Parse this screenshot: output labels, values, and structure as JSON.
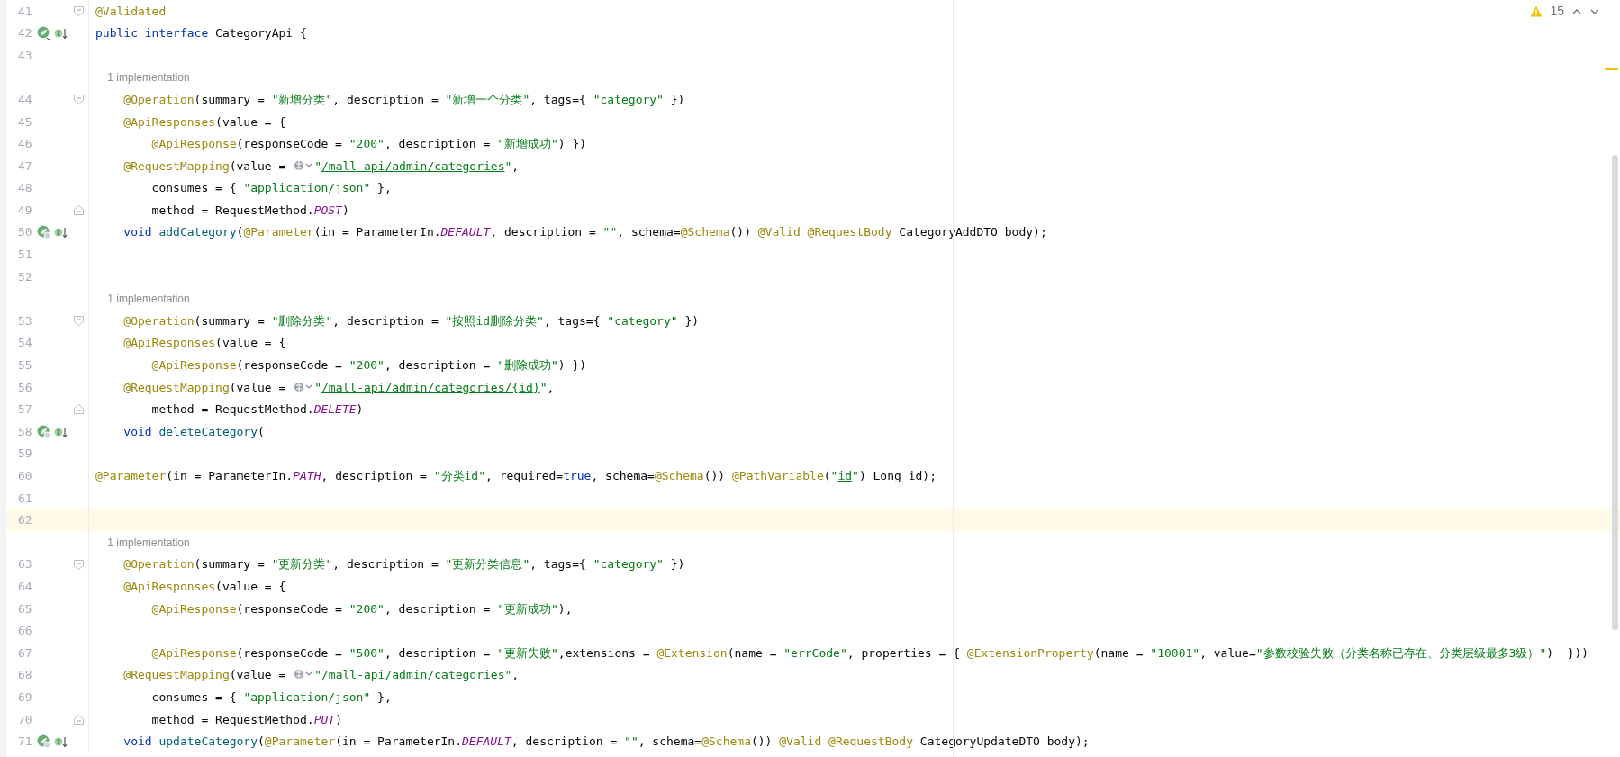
{
  "inspections": {
    "warning_count": "15"
  },
  "lines": [
    {
      "number": "41",
      "fold": {
        "kind": "start"
      },
      "tokens": [
        {
          "kind": "annotation",
          "text": "@Validated"
        }
      ]
    },
    {
      "number": "42",
      "gutter": {
        "kind": "bean"
      },
      "tokens": [
        {
          "kind": "keyword",
          "text": "public interface"
        },
        {
          "kind": "plain",
          "text": " CategoryApi {"
        }
      ]
    },
    {
      "number": "43"
    },
    {
      "hint": "    1 implementation"
    },
    {
      "number": "44",
      "fold": {
        "kind": "start"
      },
      "tokens": [
        {
          "kind": "annotation",
          "text": "    @Operation"
        },
        {
          "kind": "plain",
          "text": "(summary = "
        },
        {
          "kind": "string",
          "text": "\"新增分类\""
        },
        {
          "kind": "plain",
          "text": ", description = "
        },
        {
          "kind": "string",
          "text": "\"新增一个分类\""
        },
        {
          "kind": "plain",
          "text": ", tags={ "
        },
        {
          "kind": "string",
          "text": "\"category\""
        },
        {
          "kind": "plain",
          "text": " })"
        }
      ]
    },
    {
      "number": "45",
      "tokens": [
        {
          "kind": "annotation",
          "text": "    @ApiResponses"
        },
        {
          "kind": "plain",
          "text": "(value = {"
        }
      ]
    },
    {
      "number": "46",
      "tokens": [
        {
          "kind": "annotation",
          "text": "        @ApiResponse"
        },
        {
          "kind": "plain",
          "text": "(responseCode = "
        },
        {
          "kind": "string",
          "text": "\"200\""
        },
        {
          "kind": "plain",
          "text": ", description = "
        },
        {
          "kind": "string",
          "text": "\"新增成功\""
        },
        {
          "kind": "plain",
          "text": ") })"
        }
      ]
    },
    {
      "number": "47",
      "tokens": [
        {
          "kind": "annotation",
          "text": "    @RequestMapping"
        },
        {
          "kind": "plain",
          "text": "(value = "
        },
        {
          "kind": "web-inlay"
        },
        {
          "kind": "string",
          "text": "\""
        },
        {
          "kind": "url",
          "text": "/mall-api/admin/categories"
        },
        {
          "kind": "string",
          "text": "\""
        },
        {
          "kind": "plain",
          "text": ","
        }
      ]
    },
    {
      "number": "48",
      "tokens": [
        {
          "kind": "plain",
          "text": "        consumes = { "
        },
        {
          "kind": "string",
          "text": "\"application/json\""
        },
        {
          "kind": "plain",
          "text": " },"
        }
      ]
    },
    {
      "number": "49",
      "fold": {
        "kind": "end"
      },
      "tokens": [
        {
          "kind": "plain",
          "text": "        method = RequestMethod."
        },
        {
          "kind": "constant",
          "text": "POST"
        },
        {
          "kind": "plain",
          "text": ")"
        }
      ]
    },
    {
      "number": "50",
      "gutter": {
        "kind": "endpoint"
      },
      "tokens": [
        {
          "kind": "keyword",
          "text": "    void "
        },
        {
          "kind": "method",
          "text": "addCategory"
        },
        {
          "kind": "plain",
          "text": "("
        },
        {
          "kind": "annotation",
          "text": "@Parameter"
        },
        {
          "kind": "plain",
          "text": "(in = ParameterIn."
        },
        {
          "kind": "constant",
          "text": "DEFAULT"
        },
        {
          "kind": "plain",
          "text": ", description = "
        },
        {
          "kind": "string",
          "text": "\"\""
        },
        {
          "kind": "plain",
          "text": ", schema="
        },
        {
          "kind": "annotation",
          "text": "@Schema"
        },
        {
          "kind": "plain",
          "text": "()) "
        },
        {
          "kind": "annotation",
          "text": "@Valid @RequestBody"
        },
        {
          "kind": "plain",
          "text": " CategoryAddDTO body);"
        }
      ]
    },
    {
      "number": "51"
    },
    {
      "number": "52"
    },
    {
      "hint": "    1 implementation"
    },
    {
      "number": "53",
      "fold": {
        "kind": "start"
      },
      "tokens": [
        {
          "kind": "annotation",
          "text": "    @Operation"
        },
        {
          "kind": "plain",
          "text": "(summary = "
        },
        {
          "kind": "string",
          "text": "\"删除分类\""
        },
        {
          "kind": "plain",
          "text": ", description = "
        },
        {
          "kind": "string",
          "text": "\"按照id删除分类\""
        },
        {
          "kind": "plain",
          "text": ", tags={ "
        },
        {
          "kind": "string",
          "text": "\"category\""
        },
        {
          "kind": "plain",
          "text": " })"
        }
      ]
    },
    {
      "number": "54",
      "tokens": [
        {
          "kind": "annotation",
          "text": "    @ApiResponses"
        },
        {
          "kind": "plain",
          "text": "(value = {"
        }
      ]
    },
    {
      "number": "55",
      "tokens": [
        {
          "kind": "annotation",
          "text": "        @ApiResponse"
        },
        {
          "kind": "plain",
          "text": "(responseCode = "
        },
        {
          "kind": "string",
          "text": "\"200\""
        },
        {
          "kind": "plain",
          "text": ", description = "
        },
        {
          "kind": "string",
          "text": "\"删除成功\""
        },
        {
          "kind": "plain",
          "text": ") })"
        }
      ]
    },
    {
      "number": "56",
      "tokens": [
        {
          "kind": "annotation",
          "text": "    @RequestMapping"
        },
        {
          "kind": "plain",
          "text": "(value = "
        },
        {
          "kind": "web-inlay"
        },
        {
          "kind": "string",
          "text": "\""
        },
        {
          "kind": "url",
          "text": "/mall-api/admin/categories/{id}"
        },
        {
          "kind": "string",
          "text": "\""
        },
        {
          "kind": "plain",
          "text": ","
        }
      ]
    },
    {
      "number": "57",
      "fold": {
        "kind": "end"
      },
      "tokens": [
        {
          "kind": "plain",
          "text": "        method = RequestMethod."
        },
        {
          "kind": "constant",
          "text": "DELETE"
        },
        {
          "kind": "plain",
          "text": ")"
        }
      ]
    },
    {
      "number": "58",
      "gutter": {
        "kind": "endpoint"
      },
      "tokens": [
        {
          "kind": "keyword",
          "text": "    void "
        },
        {
          "kind": "method",
          "text": "deleteCategory"
        },
        {
          "kind": "plain",
          "text": "("
        }
      ]
    },
    {
      "number": "59"
    },
    {
      "number": "60",
      "tokens": [
        {
          "kind": "annotation",
          "text": "@Parameter"
        },
        {
          "kind": "plain",
          "text": "(in = ParameterIn."
        },
        {
          "kind": "constant",
          "text": "PATH"
        },
        {
          "kind": "plain",
          "text": ", description = "
        },
        {
          "kind": "string",
          "text": "\"分类id\""
        },
        {
          "kind": "plain",
          "text": ", required="
        },
        {
          "kind": "keyword",
          "text": "true"
        },
        {
          "kind": "plain",
          "text": ", schema="
        },
        {
          "kind": "annotation",
          "text": "@Schema"
        },
        {
          "kind": "plain",
          "text": "()) "
        },
        {
          "kind": "annotation",
          "text": "@PathVariable"
        },
        {
          "kind": "plain",
          "text": "("
        },
        {
          "kind": "string",
          "text": "\""
        },
        {
          "kind": "url",
          "text": "id"
        },
        {
          "kind": "string",
          "text": "\""
        },
        {
          "kind": "plain",
          "text": ") Long id);"
        }
      ]
    },
    {
      "number": "61"
    },
    {
      "number": "62",
      "current": true
    },
    {
      "hint": "    1 implementation"
    },
    {
      "number": "63",
      "fold": {
        "kind": "start"
      },
      "tokens": [
        {
          "kind": "annotation",
          "text": "    @Operation"
        },
        {
          "kind": "plain",
          "text": "(summary = "
        },
        {
          "kind": "string",
          "text": "\"更新分类\""
        },
        {
          "kind": "plain",
          "text": ", description = "
        },
        {
          "kind": "string",
          "text": "\"更新分类信息\""
        },
        {
          "kind": "plain",
          "text": ", tags={ "
        },
        {
          "kind": "string",
          "text": "\"category\""
        },
        {
          "kind": "plain",
          "text": " })"
        }
      ]
    },
    {
      "number": "64",
      "tokens": [
        {
          "kind": "annotation",
          "text": "    @ApiResponses"
        },
        {
          "kind": "plain",
          "text": "(value = {"
        }
      ]
    },
    {
      "number": "65",
      "tokens": [
        {
          "kind": "annotation",
          "text": "        @ApiResponse"
        },
        {
          "kind": "plain",
          "text": "(responseCode = "
        },
        {
          "kind": "string",
          "text": "\"200\""
        },
        {
          "kind": "plain",
          "text": ", description = "
        },
        {
          "kind": "string",
          "text": "\"更新成功\""
        },
        {
          "kind": "plain",
          "text": "),"
        }
      ]
    },
    {
      "number": "66"
    },
    {
      "number": "67",
      "tokens": [
        {
          "kind": "annotation",
          "text": "        @ApiResponse"
        },
        {
          "kind": "plain",
          "text": "(responseCode = "
        },
        {
          "kind": "string",
          "text": "\"500\""
        },
        {
          "kind": "plain",
          "text": ", description = "
        },
        {
          "kind": "string",
          "text": "\"更新失败\""
        },
        {
          "kind": "plain",
          "text": ",extensions = "
        },
        {
          "kind": "annotation",
          "text": "@Extension"
        },
        {
          "kind": "plain",
          "text": "(name = "
        },
        {
          "kind": "string",
          "text": "\"errCode\""
        },
        {
          "kind": "plain",
          "text": ", properties = { "
        },
        {
          "kind": "annotation",
          "text": "@ExtensionProperty"
        },
        {
          "kind": "plain",
          "text": "(name = "
        },
        {
          "kind": "string",
          "text": "\"10001\""
        },
        {
          "kind": "plain",
          "text": ", value="
        },
        {
          "kind": "string",
          "text": "\"参数校验失败（分类名称已存在、分类层级最多3级）\""
        },
        {
          "kind": "plain",
          "text": ")  }))"
        }
      ]
    },
    {
      "number": "68",
      "tokens": [
        {
          "kind": "annotation",
          "text": "    @RequestMapping"
        },
        {
          "kind": "plain",
          "text": "(value = "
        },
        {
          "kind": "web-inlay"
        },
        {
          "kind": "string",
          "text": "\""
        },
        {
          "kind": "url",
          "text": "/mall-api/admin/categories"
        },
        {
          "kind": "string",
          "text": "\""
        },
        {
          "kind": "plain",
          "text": ","
        }
      ]
    },
    {
      "number": "69",
      "tokens": [
        {
          "kind": "plain",
          "text": "        consumes = { "
        },
        {
          "kind": "string",
          "text": "\"application/json\""
        },
        {
          "kind": "plain",
          "text": " },"
        }
      ]
    },
    {
      "number": "70",
      "fold": {
        "kind": "end"
      },
      "tokens": [
        {
          "kind": "plain",
          "text": "        method = RequestMethod."
        },
        {
          "kind": "constant",
          "text": "PUT"
        },
        {
          "kind": "plain",
          "text": ")"
        }
      ]
    },
    {
      "number": "71",
      "gutter": {
        "kind": "endpoint"
      },
      "tokens": [
        {
          "kind": "keyword",
          "text": "    void "
        },
        {
          "kind": "method",
          "text": "updateCategory"
        },
        {
          "kind": "plain",
          "text": "("
        },
        {
          "kind": "annotation",
          "text": "@Parameter"
        },
        {
          "kind": "plain",
          "text": "(in = ParameterIn."
        },
        {
          "kind": "constant",
          "text": "DEFAULT"
        },
        {
          "kind": "plain",
          "text": ", description = "
        },
        {
          "kind": "string",
          "text": "\"\""
        },
        {
          "kind": "plain",
          "text": ", schema="
        },
        {
          "kind": "annotation",
          "text": "@Schema"
        },
        {
          "kind": "plain",
          "text": "()) "
        },
        {
          "kind": "annotation",
          "text": "@Valid @RequestBody"
        },
        {
          "kind": "plain",
          "text": " CategoryUpdateDTO body);"
        }
      ]
    }
  ]
}
